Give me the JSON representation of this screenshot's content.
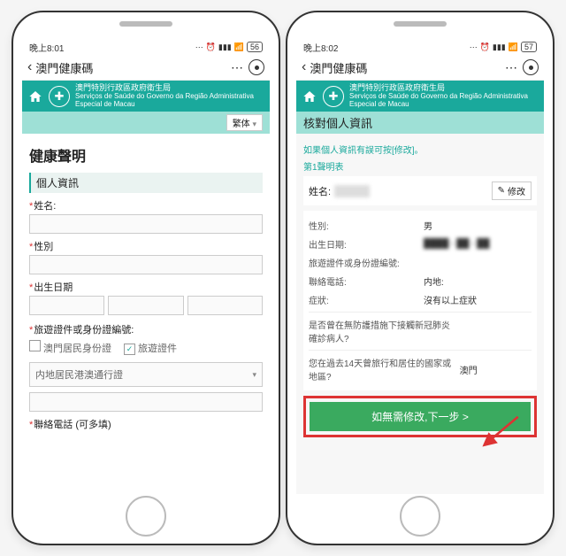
{
  "left": {
    "statusTime": "晚上8:01",
    "batteryText": "56",
    "navTitle": "澳門健康碼",
    "bannerCn": "澳門特別行政區政府衛生局",
    "bannerPt": "Serviços de Saúde do Governo da Região Administrativa Especial de Macau",
    "langLabel": "繁体",
    "pageTitle": "健康聲明",
    "sectionPersonal": "個人資訊",
    "labelName": "姓名:",
    "labelGender": "性別",
    "labelDob": "出生日期",
    "labelIdDoc": "旅遊證件或身份證編號:",
    "cbMacauId": "澳門居民身份證",
    "cbTravelDoc": "旅遊證件",
    "selectorMainland": "内地居民港澳通行證",
    "labelPhone": "聯絡電話 (可多填)"
  },
  "right": {
    "statusTime": "晚上8:02",
    "batteryText": "57",
    "navTitle": "澳門健康碼",
    "bannerCn": "澳門特別行政區政府衛生局",
    "bannerPt": "Serviços de Saúde do Governo da Região Administrativa Especial de Macau",
    "sectionTitle": "核對個人資訊",
    "hint1": "如果個人資訊有誤可按[修改]。",
    "hint2": "第1聲明表",
    "labelName": "姓名:",
    "editBtn": "修改",
    "rowGender": "性別:",
    "rowGenderVal": "男",
    "rowDob": "出生日期:",
    "rowIdDoc": "旅遊證件或身份證編號:",
    "rowPhone": "聯絡電話:",
    "rowPhoneVal": "内地:",
    "rowSymptom": "症狀:",
    "rowSymptomVal": "沒有以上症狀",
    "rowContact": "是否曾在無防護措施下接觸新冠肺炎確診病人?",
    "rowTravel": "您在過去14天曾旅行和居住的國家或地區?",
    "rowTravelVal": "澳門",
    "nextBtn": "如無需修改,下一步 >"
  }
}
